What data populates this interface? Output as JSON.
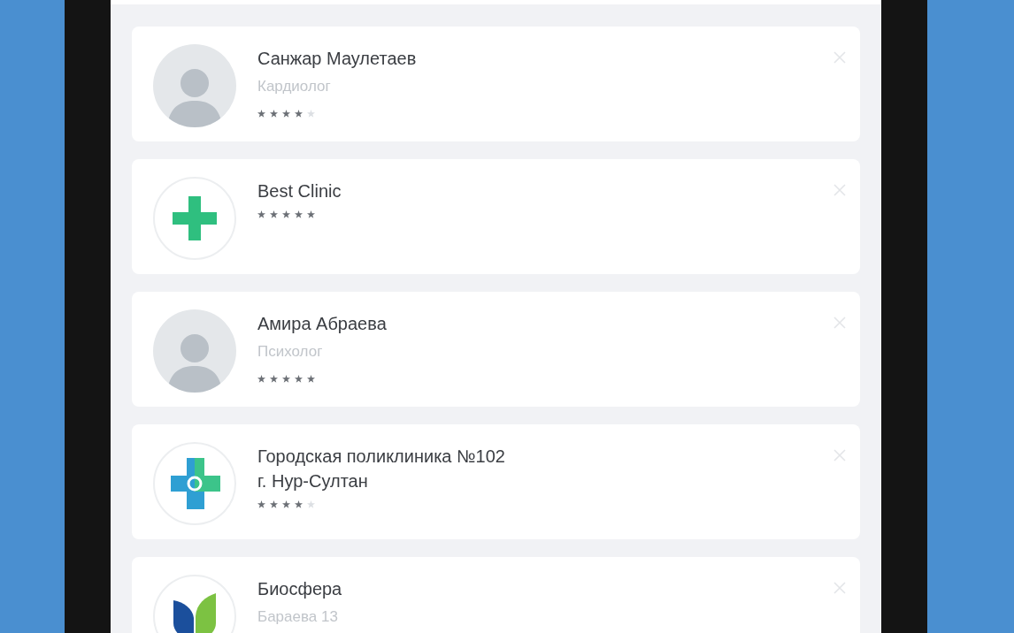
{
  "items": [
    {
      "kind": "doctor",
      "avatar": {
        "kind": "photo"
      },
      "name": "Санжар Маулетаев",
      "subtitle": "Кардиолог",
      "stars": 4
    },
    {
      "kind": "clinic",
      "avatar": {
        "kind": "green-cross"
      },
      "name": "Best Clinic",
      "stars": 5
    },
    {
      "kind": "doctor",
      "avatar": {
        "kind": "photo"
      },
      "name": "Амира Абраева",
      "subtitle": "Психолог",
      "stars": 5
    },
    {
      "kind": "clinic",
      "avatar": {
        "kind": "clinic-cross"
      },
      "name": "Городская поликлиника №102",
      "address": "г. Нур-Султан",
      "stars": 4
    },
    {
      "kind": "clinic",
      "avatar": {
        "kind": "leaf"
      },
      "name": "Биосфера",
      "subtitle": "Бараева 13"
    }
  ]
}
